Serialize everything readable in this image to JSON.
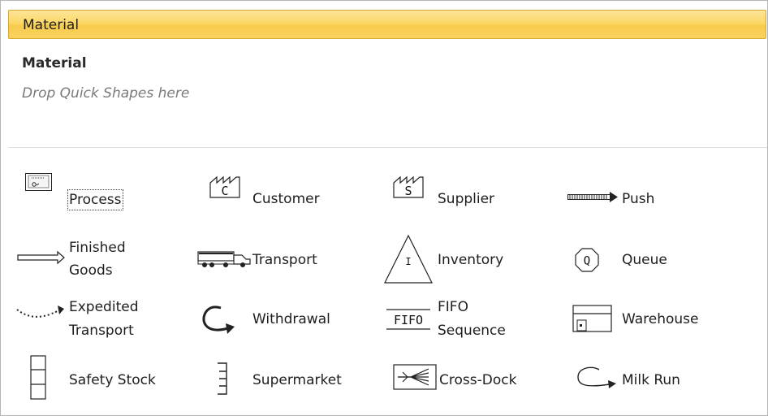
{
  "header": {
    "title": "Material"
  },
  "stencil": {
    "title": "Material",
    "quick_shapes_hint": "Drop Quick Shapes here"
  },
  "shapes": [
    {
      "label": "Process",
      "icon": "process-icon"
    },
    {
      "label": "Customer",
      "icon": "customer-factory-icon"
    },
    {
      "label": "Supplier",
      "icon": "supplier-factory-icon"
    },
    {
      "label": "Push",
      "icon": "push-arrow-icon"
    },
    {
      "label_lines": [
        "Finished",
        "Goods"
      ],
      "icon": "finished-goods-arrow-icon"
    },
    {
      "label": "Transport",
      "icon": "truck-icon"
    },
    {
      "label": "Inventory",
      "icon": "inventory-triangle-icon"
    },
    {
      "label": "Queue",
      "icon": "queue-octagon-icon"
    },
    {
      "label_lines": [
        "Expedited",
        "Transport"
      ],
      "icon": "expedited-transport-icon"
    },
    {
      "label": "Withdrawal",
      "icon": "withdrawal-arrow-icon"
    },
    {
      "label_lines": [
        "FIFO",
        "Sequence"
      ],
      "icon": "fifo-lane-icon",
      "icon_text": "FIFO"
    },
    {
      "label": "Warehouse",
      "icon": "warehouse-icon"
    },
    {
      "label": "Safety Stock",
      "icon": "safety-stock-icon"
    },
    {
      "label": "Supermarket",
      "icon": "supermarket-icon"
    },
    {
      "label": "Cross-Dock",
      "icon": "cross-dock-icon"
    },
    {
      "label": "Milk Run",
      "icon": "milk-run-icon"
    }
  ],
  "glyphs": {
    "customer": "C",
    "supplier": "S",
    "inventory": "I",
    "queue": "Q"
  },
  "selected_shape": "Process"
}
